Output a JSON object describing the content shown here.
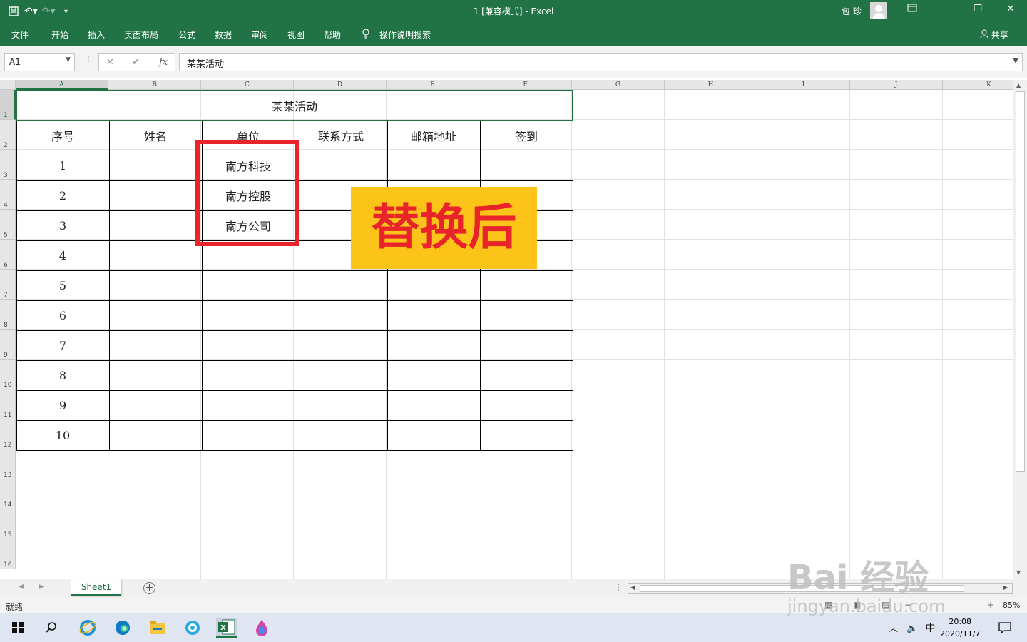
{
  "window": {
    "title": "1  [兼容模式]  -  Excel",
    "user": "包 珍"
  },
  "ribbon": {
    "tabs": [
      "文件",
      "开始",
      "插入",
      "页面布局",
      "公式",
      "数据",
      "审阅",
      "视图",
      "帮助"
    ],
    "search": "操作说明搜索",
    "share": "共享"
  },
  "formula_bar": {
    "name_box": "A1",
    "value": "某某活动"
  },
  "grid": {
    "columns": [
      "A",
      "B",
      "C",
      "D",
      "E",
      "F",
      "G",
      "H",
      "I",
      "J",
      "K"
    ],
    "rows": [
      "1",
      "2",
      "3",
      "4",
      "5",
      "6",
      "7",
      "8",
      "9",
      "10",
      "11",
      "12",
      "13",
      "14",
      "15",
      "16"
    ],
    "selected_cell": "A1"
  },
  "table": {
    "title": "某某活动",
    "headers": [
      "序号",
      "姓名",
      "单位",
      "联系方式",
      "邮箱地址",
      "签到"
    ],
    "rows": [
      [
        "1",
        "",
        "南方科技",
        "",
        "",
        ""
      ],
      [
        "2",
        "",
        "南方控股",
        "",
        "",
        ""
      ],
      [
        "3",
        "",
        "南方公司",
        "",
        "",
        ""
      ],
      [
        "4",
        "",
        "",
        "",
        "",
        ""
      ],
      [
        "5",
        "",
        "",
        "",
        "",
        ""
      ],
      [
        "6",
        "",
        "",
        "",
        "",
        ""
      ],
      [
        "7",
        "",
        "",
        "",
        "",
        ""
      ],
      [
        "8",
        "",
        "",
        "",
        "",
        ""
      ],
      [
        "9",
        "",
        "",
        "",
        "",
        ""
      ],
      [
        "10",
        "",
        "",
        "",
        "",
        ""
      ]
    ]
  },
  "annotation": {
    "label": "替换后",
    "box_color": "#e8232a",
    "label_bg": "#fcc419"
  },
  "sheets": [
    "Sheet1"
  ],
  "status": {
    "text": "就绪",
    "zoom": "85%"
  },
  "taskbar": {
    "time": "20:08",
    "date": "2020/11/7",
    "ime": "中"
  },
  "watermark": {
    "brand": "Bai  经验",
    "url": "jingyan.baidu.com"
  },
  "colors": {
    "excel_green": "#217346"
  }
}
